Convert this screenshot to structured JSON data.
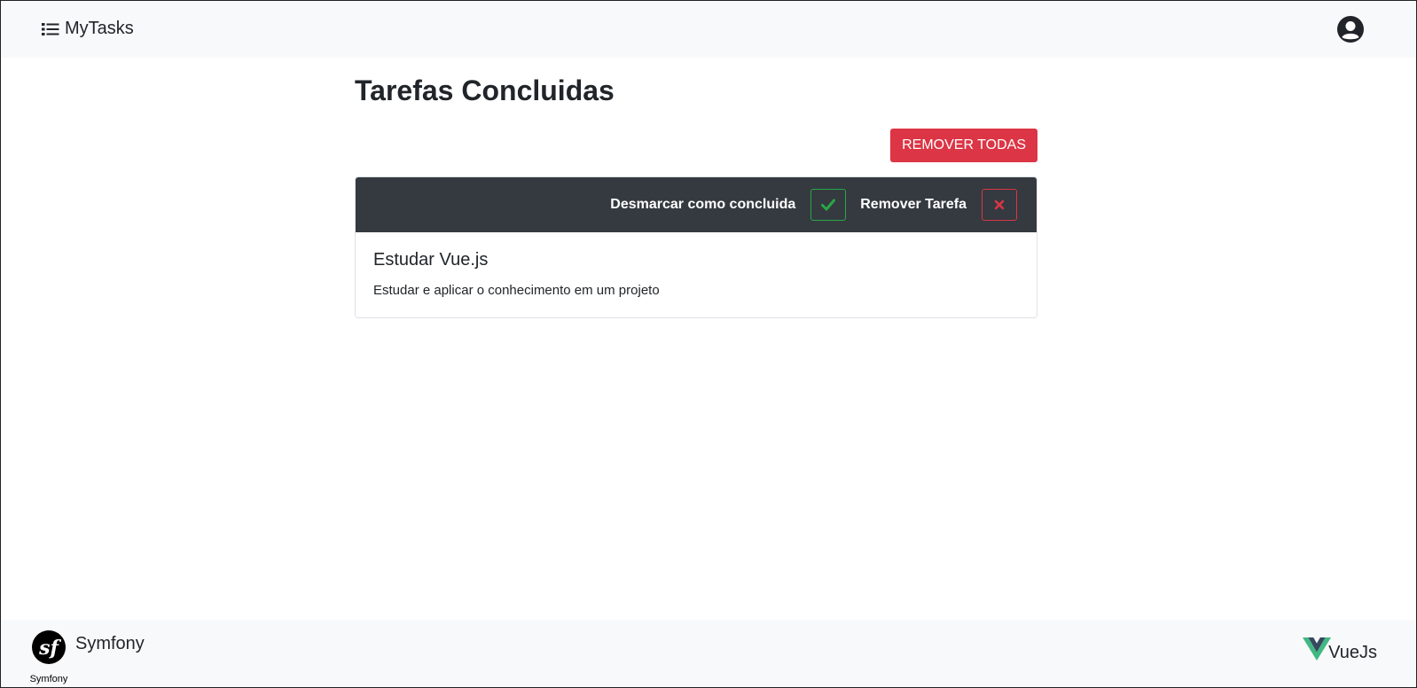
{
  "navbar": {
    "brand_label": "MyTasks",
    "brand_icon": "list-icon",
    "user_icon": "user-circle-icon"
  },
  "page": {
    "title": "Tarefas Concluidas",
    "remove_all_label": "REMOVER TODAS"
  },
  "task": {
    "unmark_label": "Desmarcar como concluida",
    "remove_label": "Remover Tarefa",
    "title": "Estudar Vue.js",
    "description": "Estudar e aplicar o conhecimento em um projeto"
  },
  "footer": {
    "symfony_label": "Symfony",
    "symfony_logo_text": "Symfony",
    "vue_label": "VueJs"
  },
  "colors": {
    "danger": "#dc3545",
    "success": "#28a745",
    "dark": "#343a40",
    "light": "#f8f9fa",
    "vue_green": "#41b883",
    "vue_dark": "#35495e"
  }
}
